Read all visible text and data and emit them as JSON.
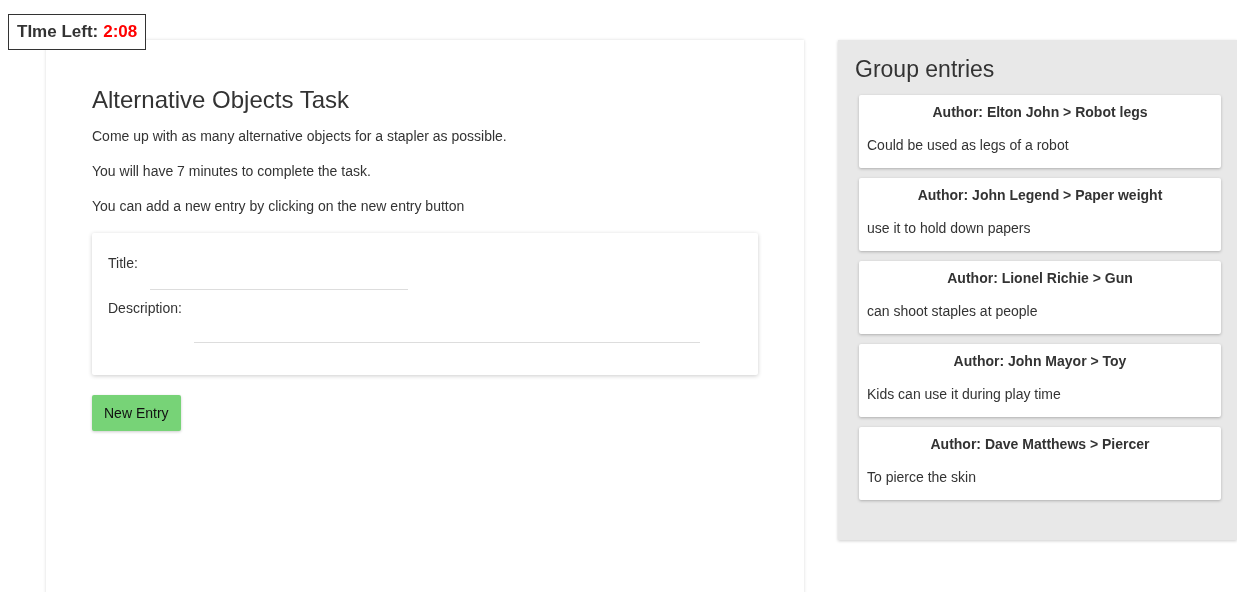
{
  "timer": {
    "label": "TIme Left:",
    "value": "2:08"
  },
  "task": {
    "title": "Alternative Objects Task",
    "paragraphs": [
      "Come up with as many alternative objects for a stapler as possible.",
      "You will have 7 minutes to complete the task.",
      "You can add a new entry by clicking on the new entry button"
    ],
    "form": {
      "title_label": "Title:",
      "description_label": "Description:"
    },
    "button": "New Entry"
  },
  "group": {
    "title": "Group entries",
    "entries": [
      {
        "heading": "Author: Elton John > Robot legs",
        "text": "Could be used as legs of a robot"
      },
      {
        "heading": "Author: John Legend > Paper weight",
        "text": "use it to hold down papers"
      },
      {
        "heading": "Author: Lionel Richie > Gun",
        "text": "can shoot staples at people"
      },
      {
        "heading": "Author: John Mayor > Toy",
        "text": "Kids can use it during play time"
      },
      {
        "heading": "Author: Dave Matthews > Piercer",
        "text": "To pierce the skin"
      }
    ]
  }
}
